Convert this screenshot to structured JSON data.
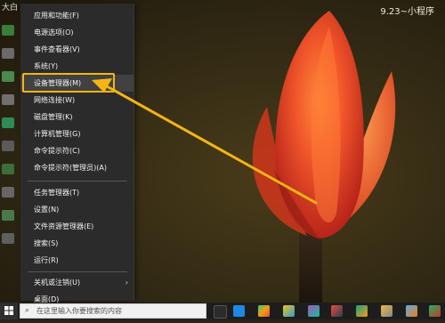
{
  "desktop": {
    "title_left": "大白",
    "title_right": "9.23~小程序"
  },
  "menu": {
    "items": [
      {
        "label": "应用和功能(F)"
      },
      {
        "label": "电源选项(O)"
      },
      {
        "label": "事件查看器(V)"
      },
      {
        "label": "系统(Y)"
      },
      {
        "label": "设备管理器(M)"
      },
      {
        "label": "网络连接(W)"
      },
      {
        "label": "磁盘管理(K)"
      },
      {
        "label": "计算机管理(G)"
      },
      {
        "label": "命令提示符(C)"
      },
      {
        "label": "命令提示符(管理员)(A)"
      },
      {
        "label": "任务管理器(T)"
      },
      {
        "label": "设置(N)"
      },
      {
        "label": "文件资源管理器(E)"
      },
      {
        "label": "搜索(S)"
      },
      {
        "label": "运行(R)"
      },
      {
        "label": "关机或注销(U)"
      },
      {
        "label": "桌面(D)"
      }
    ],
    "highlighted_item": "设备管理器(M)",
    "highlight_color": "#f6b514"
  },
  "taskbar": {
    "search_placeholder": "在这里输入你要搜索的内容",
    "icons": [
      "edge-icon",
      "app-icon",
      "app-icon",
      "app-icon",
      "app-icon",
      "app-icon",
      "app-icon",
      "app-icon",
      "app-icon"
    ]
  }
}
